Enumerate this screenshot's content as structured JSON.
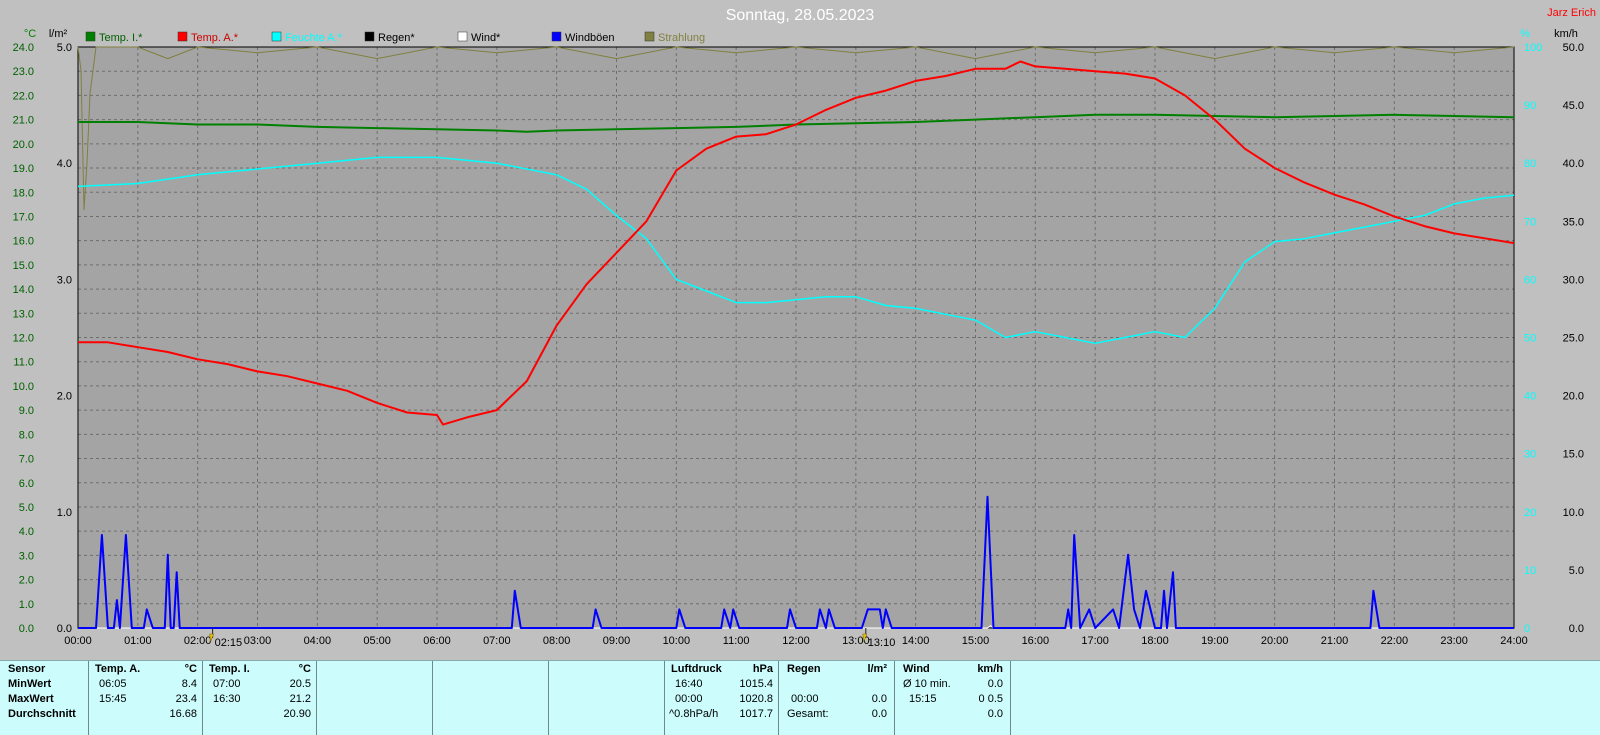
{
  "title": "Sonntag, 28.05.2023",
  "author": "Jarz Erich",
  "axes": {
    "left1_unit": "°C",
    "left2_unit": "l/m²",
    "right1_unit": "%",
    "right2_unit": "km/h",
    "temp_ticks": [
      "0.0",
      "1.0",
      "2.0",
      "3.0",
      "4.0",
      "5.0",
      "6.0",
      "7.0",
      "8.0",
      "9.0",
      "10.0",
      "11.0",
      "12.0",
      "13.0",
      "14.0",
      "15.0",
      "16.0",
      "17.0",
      "18.0",
      "19.0",
      "20.0",
      "21.0",
      "22.0",
      "23.0",
      "24.0"
    ],
    "rain_ticks": [
      "0.0",
      "1.0",
      "2.0",
      "3.0",
      "4.0",
      "5.0"
    ],
    "hum_ticks": [
      "0",
      "10",
      "20",
      "30",
      "40",
      "50",
      "60",
      "70",
      "80",
      "90",
      "100"
    ],
    "wind_ticks": [
      "0.0",
      "5.0",
      "10.0",
      "15.0",
      "20.0",
      "25.0",
      "30.0",
      "35.0",
      "40.0",
      "45.0",
      "50.0"
    ],
    "time_ticks": [
      "00:00",
      "01:00",
      "02:00",
      "03:00",
      "04:00",
      "05:00",
      "06:00",
      "07:00",
      "08:00",
      "09:00",
      "10:00",
      "11:00",
      "12:00",
      "13:00",
      "14:00",
      "15:00",
      "16:00",
      "17:00",
      "18:00",
      "19:00",
      "20:00",
      "21:00",
      "22:00",
      "23:00",
      "24:00"
    ]
  },
  "markers": [
    {
      "label": "02:15",
      "x": 2.25
    },
    {
      "label": "13:10",
      "x": 13.1667
    }
  ],
  "colors": {
    "temp_in": "#008000",
    "temp_out": "#ff0000",
    "humidity": "#00ffff",
    "rain": "#000000",
    "wind": "#ffffff",
    "gusts": "#0000ff",
    "radiation": "#808040"
  },
  "chart_data": {
    "type": "line",
    "title": "Sonntag, 28.05.2023",
    "x_unit": "hours",
    "xlim": [
      0,
      24
    ],
    "grid": true,
    "legend_position": "top-left",
    "scales": {
      "temp": {
        "unit": "°C",
        "lim": [
          0,
          24
        ]
      },
      "rain": {
        "unit": "l/m²",
        "lim": [
          0,
          5
        ]
      },
      "humidity": {
        "unit": "%",
        "lim": [
          0,
          100
        ]
      },
      "wind": {
        "unit": "km/h",
        "lim": [
          0,
          50
        ]
      }
    },
    "series": [
      {
        "name": "Temp. I.*",
        "scale": "temp",
        "color": "#008000",
        "points": [
          [
            0,
            20.9
          ],
          [
            1,
            20.9
          ],
          [
            2,
            20.8
          ],
          [
            3,
            20.8
          ],
          [
            4,
            20.7
          ],
          [
            5,
            20.65
          ],
          [
            6,
            20.6
          ],
          [
            7,
            20.55
          ],
          [
            7.5,
            20.5
          ],
          [
            8,
            20.55
          ],
          [
            9,
            20.6
          ],
          [
            10,
            20.65
          ],
          [
            11,
            20.7
          ],
          [
            12,
            20.8
          ],
          [
            13,
            20.85
          ],
          [
            14,
            20.9
          ],
          [
            15,
            21.0
          ],
          [
            16,
            21.1
          ],
          [
            16.5,
            21.15
          ],
          [
            17,
            21.2
          ],
          [
            18,
            21.2
          ],
          [
            19,
            21.15
          ],
          [
            20,
            21.1
          ],
          [
            21,
            21.15
          ],
          [
            22,
            21.2
          ],
          [
            23,
            21.15
          ],
          [
            24,
            21.1
          ]
        ]
      },
      {
        "name": "Temp. A.*",
        "scale": "temp",
        "color": "#ff0000",
        "points": [
          [
            0,
            11.8
          ],
          [
            0.5,
            11.8
          ],
          [
            1,
            11.6
          ],
          [
            1.5,
            11.4
          ],
          [
            2,
            11.1
          ],
          [
            2.5,
            10.9
          ],
          [
            3,
            10.6
          ],
          [
            3.5,
            10.4
          ],
          [
            4,
            10.1
          ],
          [
            4.5,
            9.8
          ],
          [
            5,
            9.3
          ],
          [
            5.5,
            8.9
          ],
          [
            6,
            8.8
          ],
          [
            6.1,
            8.4
          ],
          [
            6.5,
            8.7
          ],
          [
            7,
            9.0
          ],
          [
            7.5,
            10.2
          ],
          [
            8,
            12.5
          ],
          [
            8.5,
            14.2
          ],
          [
            9,
            15.5
          ],
          [
            9.5,
            16.8
          ],
          [
            10,
            18.9
          ],
          [
            10.5,
            19.8
          ],
          [
            11,
            20.3
          ],
          [
            11.5,
            20.4
          ],
          [
            12,
            20.8
          ],
          [
            12.5,
            21.4
          ],
          [
            13,
            21.9
          ],
          [
            13.5,
            22.2
          ],
          [
            14,
            22.6
          ],
          [
            14.5,
            22.8
          ],
          [
            15,
            23.1
          ],
          [
            15.5,
            23.1
          ],
          [
            15.75,
            23.4
          ],
          [
            16,
            23.2
          ],
          [
            16.5,
            23.1
          ],
          [
            17,
            23.0
          ],
          [
            17.5,
            22.9
          ],
          [
            18,
            22.7
          ],
          [
            18.5,
            22.0
          ],
          [
            19,
            21.0
          ],
          [
            19.5,
            19.8
          ],
          [
            20,
            19.0
          ],
          [
            20.5,
            18.4
          ],
          [
            21,
            17.9
          ],
          [
            21.5,
            17.5
          ],
          [
            22,
            17.0
          ],
          [
            22.5,
            16.6
          ],
          [
            23,
            16.3
          ],
          [
            23.5,
            16.1
          ],
          [
            24,
            15.9
          ]
        ]
      },
      {
        "name": "Feuchte A.*",
        "scale": "humidity",
        "color": "#00ffff",
        "points": [
          [
            0,
            76
          ],
          [
            1,
            76.5
          ],
          [
            2,
            78
          ],
          [
            3,
            79
          ],
          [
            4,
            80
          ],
          [
            5,
            81
          ],
          [
            6,
            81
          ],
          [
            7,
            80
          ],
          [
            8,
            78
          ],
          [
            8.5,
            75.5
          ],
          [
            9,
            71
          ],
          [
            9.5,
            67
          ],
          [
            10,
            60
          ],
          [
            10.5,
            58
          ],
          [
            11,
            56
          ],
          [
            11.5,
            56
          ],
          [
            12,
            56.5
          ],
          [
            12.5,
            57
          ],
          [
            13,
            57
          ],
          [
            13.5,
            55.5
          ],
          [
            14,
            55
          ],
          [
            14.5,
            54
          ],
          [
            15,
            53
          ],
          [
            15.5,
            50
          ],
          [
            16,
            51
          ],
          [
            16.5,
            50
          ],
          [
            17,
            49
          ],
          [
            17.5,
            50
          ],
          [
            18,
            51
          ],
          [
            18.5,
            50
          ],
          [
            19,
            55
          ],
          [
            19.5,
            63
          ],
          [
            20,
            66.5
          ],
          [
            20.5,
            67
          ],
          [
            21,
            68
          ],
          [
            21.5,
            69
          ],
          [
            22,
            70
          ],
          [
            22.5,
            71
          ],
          [
            23,
            73
          ],
          [
            23.5,
            74
          ],
          [
            24,
            74.5
          ]
        ]
      },
      {
        "name": "Regen*",
        "scale": "rain",
        "color": "#000000",
        "points": [
          [
            0,
            0
          ],
          [
            24,
            0
          ]
        ]
      },
      {
        "name": "Wind*",
        "scale": "wind",
        "color": "#ffffff",
        "points": [
          [
            0,
            0
          ],
          [
            15.2,
            0
          ],
          [
            15.25,
            0.2
          ],
          [
            15.3,
            0
          ],
          [
            24,
            0
          ]
        ]
      },
      {
        "name": "Windböen",
        "scale": "wind",
        "color": "#0000ff",
        "points": [
          [
            0,
            0
          ],
          [
            0.3,
            0
          ],
          [
            0.4,
            8
          ],
          [
            0.5,
            0
          ],
          [
            0.6,
            0
          ],
          [
            0.65,
            2.4
          ],
          [
            0.7,
            0
          ],
          [
            0.8,
            8
          ],
          [
            0.9,
            0
          ],
          [
            1.1,
            0
          ],
          [
            1.15,
            1.6
          ],
          [
            1.25,
            0
          ],
          [
            1.45,
            0
          ],
          [
            1.5,
            6.3
          ],
          [
            1.55,
            0
          ],
          [
            1.6,
            0
          ],
          [
            1.65,
            4.8
          ],
          [
            1.7,
            0
          ],
          [
            7.25,
            0
          ],
          [
            7.3,
            3.2
          ],
          [
            7.4,
            0
          ],
          [
            8.6,
            0
          ],
          [
            8.65,
            1.6
          ],
          [
            8.75,
            0
          ],
          [
            10,
            0
          ],
          [
            10.05,
            1.6
          ],
          [
            10.15,
            0
          ],
          [
            10.75,
            0
          ],
          [
            10.8,
            1.6
          ],
          [
            10.9,
            0
          ],
          [
            10.95,
            1.6
          ],
          [
            11.05,
            0
          ],
          [
            11.85,
            0
          ],
          [
            11.9,
            1.6
          ],
          [
            12,
            0
          ],
          [
            12.35,
            0
          ],
          [
            12.4,
            1.6
          ],
          [
            12.5,
            0
          ],
          [
            12.55,
            1.6
          ],
          [
            12.65,
            0
          ],
          [
            13.1,
            0
          ],
          [
            13.2,
            1.6
          ],
          [
            13.4,
            1.6
          ],
          [
            13.45,
            0
          ],
          [
            13.5,
            1.6
          ],
          [
            13.6,
            0
          ],
          [
            15.1,
            0
          ],
          [
            15.2,
            11.3
          ],
          [
            15.3,
            0
          ],
          [
            16.5,
            0
          ],
          [
            16.55,
            1.6
          ],
          [
            16.6,
            0
          ],
          [
            16.65,
            8
          ],
          [
            16.75,
            0
          ],
          [
            16.9,
            1.6
          ],
          [
            17,
            0
          ],
          [
            17.3,
            1.6
          ],
          [
            17.4,
            0
          ],
          [
            17.55,
            6.3
          ],
          [
            17.65,
            1.6
          ],
          [
            17.75,
            0
          ],
          [
            17.85,
            3.2
          ],
          [
            18,
            0
          ],
          [
            18.1,
            0
          ],
          [
            18.15,
            3.2
          ],
          [
            18.2,
            0
          ],
          [
            18.3,
            4.8
          ],
          [
            18.35,
            0
          ],
          [
            21.6,
            0
          ],
          [
            21.65,
            3.2
          ],
          [
            21.75,
            0
          ],
          [
            24,
            0
          ]
        ]
      },
      {
        "name": "Strahlung",
        "scale": "humidity",
        "color": "#808040",
        "points": [
          [
            0,
            100
          ],
          [
            0.05,
            96
          ],
          [
            0.1,
            72
          ],
          [
            0.15,
            80
          ],
          [
            0.2,
            92
          ],
          [
            0.3,
            100
          ],
          [
            1,
            100
          ],
          [
            1.5,
            98
          ],
          [
            2,
            100
          ],
          [
            3,
            99
          ],
          [
            4,
            100
          ],
          [
            5,
            98
          ],
          [
            6,
            100
          ],
          [
            7,
            99
          ],
          [
            8,
            100
          ],
          [
            9,
            98
          ],
          [
            10,
            100
          ],
          [
            11,
            99
          ],
          [
            12,
            100
          ],
          [
            13,
            99
          ],
          [
            14,
            100
          ],
          [
            15,
            98
          ],
          [
            16,
            100
          ],
          [
            17,
            99
          ],
          [
            18,
            100
          ],
          [
            19,
            98
          ],
          [
            20,
            100
          ],
          [
            21,
            99
          ],
          [
            22,
            100
          ],
          [
            23,
            99
          ],
          [
            24,
            100
          ]
        ]
      }
    ]
  },
  "stats": {
    "sensor": {
      "title": "Sensor",
      "rows": [
        "MinWert",
        "MaxWert",
        "Durchschnitt"
      ]
    },
    "temp_out": {
      "title": "Temp. A.",
      "unit": "°C",
      "min_time": "06:05",
      "min_val": "8.4",
      "max_time": "15:45",
      "max_val": "23.4",
      "avg": "16.68"
    },
    "temp_in": {
      "title": "Temp. I.",
      "unit": "°C",
      "min_time": "07:00",
      "min_val": "20.5",
      "max_time": "16:30",
      "max_val": "21.2",
      "avg": "20.90"
    },
    "pressure": {
      "title": "Luftdruck",
      "unit": "hPa",
      "r1_time": "16:40",
      "r1_val": "1015.4",
      "r2_time": "00:00",
      "r2_val": "1020.8",
      "r3_label": "^0.8hPa/h",
      "r3_val": "1017.7"
    },
    "rain": {
      "title": "Regen",
      "unit": "l/m²",
      "r2_time": "00:00",
      "r2_val": "0.0",
      "r3_label": "Gesamt:",
      "r3_val": "0.0"
    },
    "wind": {
      "title": "Wind",
      "unit": "km/h",
      "r1_label": "Ø 10 min.",
      "r1_val": "0.0",
      "r2_time": "15:15",
      "r2_val": "0 0.5",
      "r3_val": "0.0"
    }
  }
}
